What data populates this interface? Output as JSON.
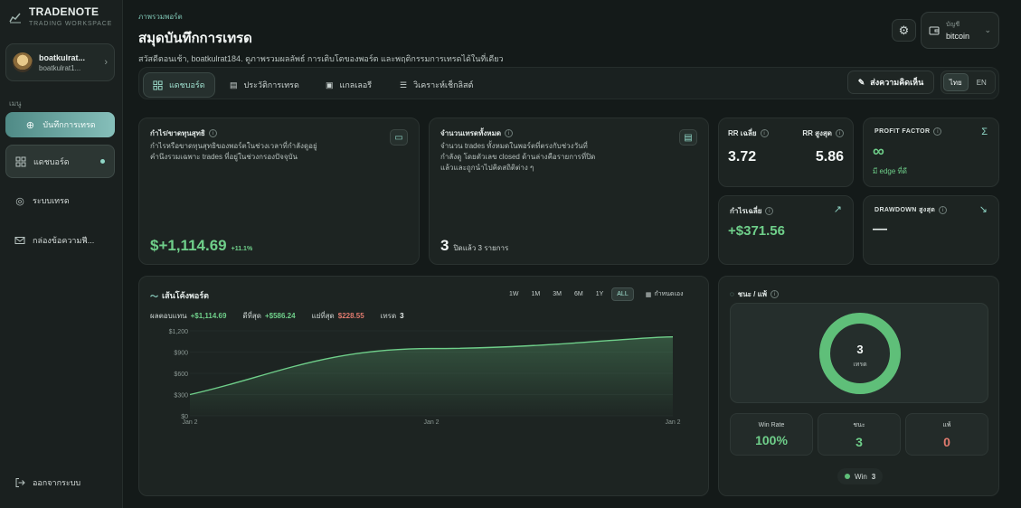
{
  "brand": {
    "title": "TRADENOTE",
    "subtitle": "TRADING WORKSPACE"
  },
  "profile": {
    "name": "boatkulrat...",
    "sub": "boatkulrat1..."
  },
  "sidebar": {
    "menu_label": "เมนู",
    "cta": "บันทึกการเทรด",
    "items": [
      {
        "label": "แดชบอร์ด",
        "icon": "dashboard-icon"
      },
      {
        "label": "ระบบเทรด",
        "icon": "system-icon"
      },
      {
        "label": "กล่องข้อความฟี..."
      }
    ],
    "logout": "ออกจากระบบ"
  },
  "header": {
    "crumb": "ภาพรวมพอร์ต",
    "title": "สมุดบันทึกการเทรด",
    "subtitle": "สวัสดีตอนเช้า, boatkulrat184. ดูภาพรวมผลลัพธ์ การเติบโตของพอร์ต และพฤติกรรมการเทรดได้ในที่เดียว"
  },
  "account": {
    "label": "บัญชี",
    "value": "bitcoin"
  },
  "tabs": [
    {
      "label": "แดชบอร์ด"
    },
    {
      "label": "ประวัติการเทรด"
    },
    {
      "label": "แกลเลอรี"
    },
    {
      "label": "วิเคราะห์เช็กลิสต์"
    }
  ],
  "feedback": "ส่งความคิดเห็น",
  "lang": {
    "th": "ไทย",
    "en": "EN"
  },
  "pnl": {
    "title": "กำไร/ขาดทุนสุทธิ",
    "desc": "กำไรหรือขาดทุนสุทธิของพอร์ตในช่วงเวลาที่กำลังดูอยู่ คำนึงรวมเฉพาะ trades ที่อยู่ในช่วงกรองปัจจุบัน",
    "value": "$+1,114.69",
    "pct": "+11.1%"
  },
  "count": {
    "title": "จำนวนเทรดทั้งหมด",
    "desc": "จำนวน trades ทั้งหมดในพอร์ตที่ตรงกับช่วงวันที่กำลังดู โดยตัวเลข closed ด้านล่างคือรายการที่ปิดแล้วและถูกนำไปคิดสถิติต่าง ๆ",
    "value": "3",
    "sub": "ปิดแล้ว 3 รายการ"
  },
  "rr": {
    "avg_label": "RR เฉลี่ย",
    "max_label": "RR สูงสุด",
    "avg": "3.72",
    "max": "5.86"
  },
  "pf": {
    "title": "PROFIT FACTOR",
    "value": "∞",
    "sub": "มี edge ที่ดี"
  },
  "avgprofit": {
    "title": "กำไรเฉลี่ย",
    "value": "+$371.56"
  },
  "dd": {
    "title": "DRAWDOWN สูงสุด",
    "value": "—"
  },
  "equity": {
    "title": "เส้นโค้งพอร์ต",
    "ranges": [
      "1W",
      "1M",
      "3M",
      "6M",
      "1Y",
      "ALL"
    ],
    "active": "ALL",
    "custom": "กำหนดเอง",
    "stats": {
      "ret_label": "ผลตอบแทน",
      "ret": "+$1,114.69",
      "best_label": "ดีที่สุด",
      "best": "+$586.24",
      "worst_label": "แย่ที่สุด",
      "worst": "$228.55",
      "trades_label": "เทรด",
      "trades": "3"
    }
  },
  "chart_data": {
    "type": "area",
    "ylim": [
      0,
      1200
    ],
    "yticks": [
      "$0",
      "$300",
      "$600",
      "$900",
      "$1,200"
    ],
    "x": [
      "Jan 2",
      "Jan 2",
      "Jan 2"
    ],
    "values": [
      300,
      950,
      1115
    ],
    "color": "#6fcf8a"
  },
  "winloss": {
    "title": "ชนะ / แพ้",
    "total": "3",
    "total_label": "เทรด",
    "winrate_label": "Win Rate",
    "winrate": "100%",
    "win_label": "ชนะ",
    "win": "3",
    "loss_label": "แพ้",
    "loss": "0",
    "legend_label": "Win",
    "legend_value": "3",
    "win_fraction": 1.0
  }
}
